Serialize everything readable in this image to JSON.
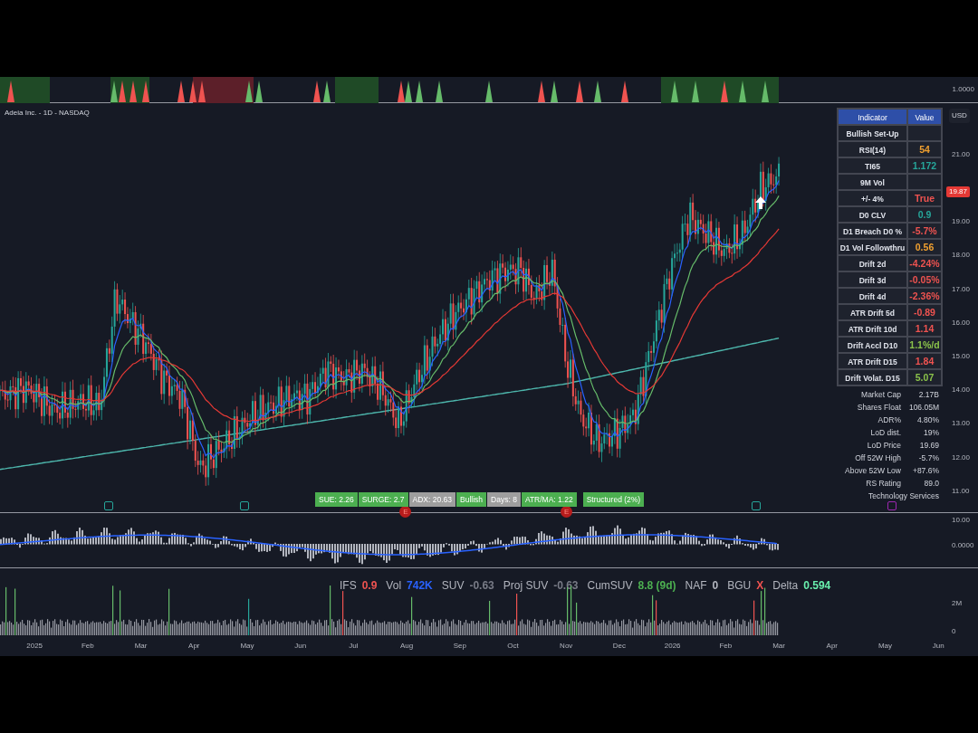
{
  "chart_title": "Adeia Inc. - 1D - NASDAQ",
  "signal_strip": {
    "axis_label": "1.0000"
  },
  "price_axis": {
    "currency": "USD",
    "last_price": "19.87",
    "labels": [
      "21.00",
      "19.00",
      "18.00",
      "17.00",
      "16.00",
      "15.00",
      "14.00",
      "13.00",
      "12.00",
      "11.00"
    ]
  },
  "markers": [
    {
      "kind": "flag",
      "color": "#26a69a"
    },
    {
      "kind": "flag",
      "color": "#26a69a"
    },
    {
      "kind": "earnings",
      "color": "#b71c1c",
      "text": "E"
    },
    {
      "kind": "earnings",
      "color": "#b71c1c",
      "text": "E"
    },
    {
      "kind": "flag",
      "color": "#26a69a"
    },
    {
      "kind": "flag",
      "color": "#9c27b0"
    }
  ],
  "badges": [
    {
      "text": "SUE: 2.26",
      "color": "#4caf50"
    },
    {
      "text": "SURGE: 2.7",
      "color": "#4caf50"
    },
    {
      "text": "ADX: 20.63",
      "color": "#9e9e9e"
    },
    {
      "text": "Bullish",
      "color": "#4caf50"
    },
    {
      "text": "Days: 8",
      "color": "#9e9e9e"
    },
    {
      "text": "ATR/MA: 1.22",
      "color": "#4caf50"
    },
    {
      "text": "Structured (2%)",
      "color": "#4caf50"
    }
  ],
  "indicator_table": {
    "columns": [
      "Indicator",
      "Value"
    ],
    "rows": [
      {
        "label": "Bullish Set-Up"
      },
      {
        "label": "RSI(14)",
        "value": "54",
        "color": "#f0a030"
      },
      {
        "label": "TI65",
        "value": "1.172",
        "color": "#26a69a"
      },
      {
        "label": "9M Vol"
      },
      {
        "label": "+/- 4%",
        "value": "True",
        "color": "#ef5350"
      },
      {
        "label": "D0 CLV",
        "value": "0.9",
        "color": "#26a69a"
      },
      {
        "label": "D1 Breach D0 %",
        "value": "-5.7%",
        "color": "#ef5350"
      },
      {
        "label": "D1 Vol Followthru",
        "value": "0.56",
        "color": "#f0a030"
      },
      {
        "label": "Drift 2d",
        "value": "-4.24%",
        "color": "#ef5350"
      },
      {
        "label": "Drift 3d",
        "value": "-0.05%",
        "color": "#ef5350"
      },
      {
        "label": "Drift 4d",
        "value": "-2.36%",
        "color": "#ef5350"
      },
      {
        "label": "ATR Drift 5d",
        "value": "-0.89",
        "color": "#ef5350"
      },
      {
        "label": "ATR Drift 10d",
        "value": "1.14",
        "color": "#ef5350"
      },
      {
        "label": "Drift Accl D10",
        "value": "1.1%/d",
        "color": "#8bc34a"
      },
      {
        "label": "ATR Drift D15",
        "value": "1.84",
        "color": "#ef5350"
      },
      {
        "label": "Drift Volat. D15",
        "value": "5.07",
        "color": "#8bc34a"
      }
    ]
  },
  "stats": [
    {
      "label": "Market Cap",
      "value": "2.17B"
    },
    {
      "label": "Shares Float",
      "value": "106.05M"
    },
    {
      "label": "ADR%",
      "value": "4.80%"
    },
    {
      "label": "LoD dist.",
      "value": "19%"
    },
    {
      "label": "LoD Price",
      "value": "19.69"
    },
    {
      "label": "Off 52W High",
      "value": "-5.7%"
    },
    {
      "label": "Above 52W Low",
      "value": "+87.6%"
    },
    {
      "label": "RS Rating",
      "value": "89.0"
    },
    {
      "label": "Technology Services"
    }
  ],
  "oscillator": {
    "axis_labels": [
      "10.00",
      "0.0000"
    ]
  },
  "volume": {
    "legend": [
      {
        "label": "IFS",
        "value": "0.9",
        "color": "#ef5350"
      },
      {
        "label": "Vol",
        "value": "742K",
        "color": "#2962ff"
      },
      {
        "label": "SUV",
        "value": "-0.63",
        "color": "#787b86"
      },
      {
        "label": "Proj SUV",
        "value": "-0.63",
        "color": "#787b86"
      },
      {
        "label": "CumSUV",
        "value": "8.8 (9d)",
        "color": "#4caf50"
      },
      {
        "label": "NAF",
        "value": "0",
        "color": "#b2b5be"
      },
      {
        "label": "BGU",
        "value": "X",
        "color": "#ef5350"
      },
      {
        "label": "Delta",
        "value": "0.594",
        "color": "#69f0ae"
      }
    ],
    "axis_labels": [
      "2M",
      "0"
    ]
  },
  "time_axis": [
    "2025",
    "Feb",
    "Mar",
    "Apr",
    "May",
    "Jun",
    "Jul",
    "Aug",
    "Sep",
    "Oct",
    "Nov",
    "Dec",
    "2026",
    "Feb",
    "Mar",
    "Apr",
    "May",
    "Jun"
  ]
}
